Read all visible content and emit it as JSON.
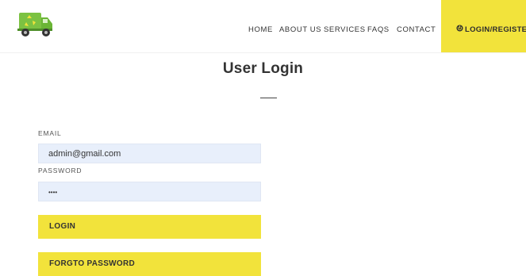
{
  "header": {
    "logo_icon": "garbage-truck-recycle-icon",
    "nav": [
      {
        "label": "HOME"
      },
      {
        "label": "ABOUT US"
      },
      {
        "label": "SERVICES"
      },
      {
        "label": "FAQS"
      },
      {
        "label": "CONTACT"
      }
    ],
    "login_register": {
      "icon": "power-icon",
      "label": "LOGIN/REGISTER"
    }
  },
  "page": {
    "title": "User Login"
  },
  "form": {
    "email": {
      "label": "EMAIL",
      "value": "admin@gmail.com"
    },
    "password": {
      "label": "PASSWORD",
      "value": "••••"
    },
    "login_button": "LOGIN",
    "forgot_button": "FORGTO PASSWORD"
  },
  "colors": {
    "accent": "#f2e33b",
    "input_bg": "#e8effb",
    "logo_green": "#7cc242"
  }
}
